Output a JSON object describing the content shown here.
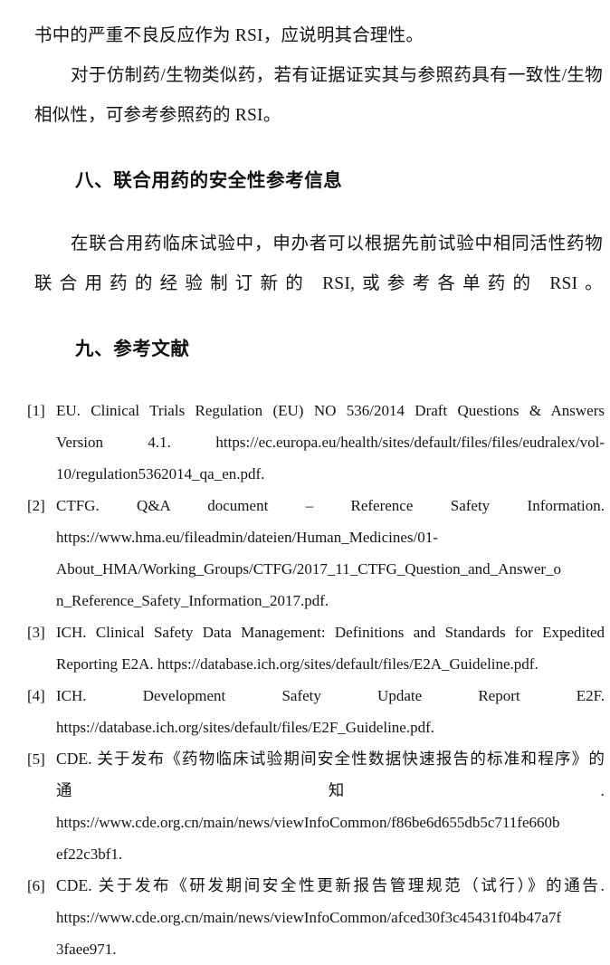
{
  "document": {
    "paragraphs": [
      {
        "id": "para-rsi-justification",
        "text": "书中的严重不良反应作为 RSI，应说明其合理性。"
      },
      {
        "id": "para-generic-biosimilar",
        "text": "对于仿制药/生物类似药，若有证据证实其与参照药具有一致性/生物相似性，可参考参照药的 RSI。"
      }
    ],
    "headings": {
      "section_eight": "八、联合用药的安全性参考信息",
      "section_nine": "九、参考文献"
    },
    "paragraph_section_eight": "在联合用药临床试验中，申办者可以根据先前试验中相同活性药物联合用药的经验制订新的 RSI,或参考各单药的 RSI。",
    "references": [
      {
        "marker": "[1]",
        "lines": [
          "EU. Clinical Trials Regulation (EU) NO 536/2014 Draft Questions & Answers",
          "Version 4.1. https://ec.europa.eu/health/sites/default/files/files/eudralex/vol-",
          "10/regulation5362014_qa_en.pdf."
        ]
      },
      {
        "marker": "[2]",
        "lines": [
          "CTFG. Q&A document – Reference Safety Information.",
          "https://www.hma.eu/fileadmin/dateien/Human_Medicines/01-",
          "About_HMA/Working_Groups/CTFG/2017_11_CTFG_Question_and_Answer_o",
          "n_Reference_Safety_Information_2017.pdf."
        ]
      },
      {
        "marker": "[3]",
        "lines": [
          "ICH. Clinical Safety Data Management: Definitions and Standards for Expedited",
          "Reporting E2A. https://database.ich.org/sites/default/files/E2A_Guideline.pdf."
        ]
      },
      {
        "marker": "[4]",
        "lines": [
          "ICH. Development Safety Update Report E2F.",
          "https://database.ich.org/sites/default/files/E2F_Guideline.pdf."
        ]
      },
      {
        "marker": "[5]",
        "lines": [
          "CDE. 关于发布《药物临床试验期间安全性数据快速报告的标准和程序》的",
          "通 知 .",
          "https://www.cde.org.cn/main/news/viewInfoCommon/f86be6d655db5c711fe660b",
          "ef22c3bf1."
        ]
      },
      {
        "marker": "[6]",
        "lines": [
          "CDE. 关于发布《研发期间安全性更新报告管理规范（试行）》的通告.",
          "https://www.cde.org.cn/main/news/viewInfoCommon/afced30f3c45431f04b47a7f",
          "3faee971."
        ]
      }
    ]
  },
  "colors": {
    "page_background": "#ffffff",
    "body_text": "#131313",
    "heading_text": "#111111"
  }
}
